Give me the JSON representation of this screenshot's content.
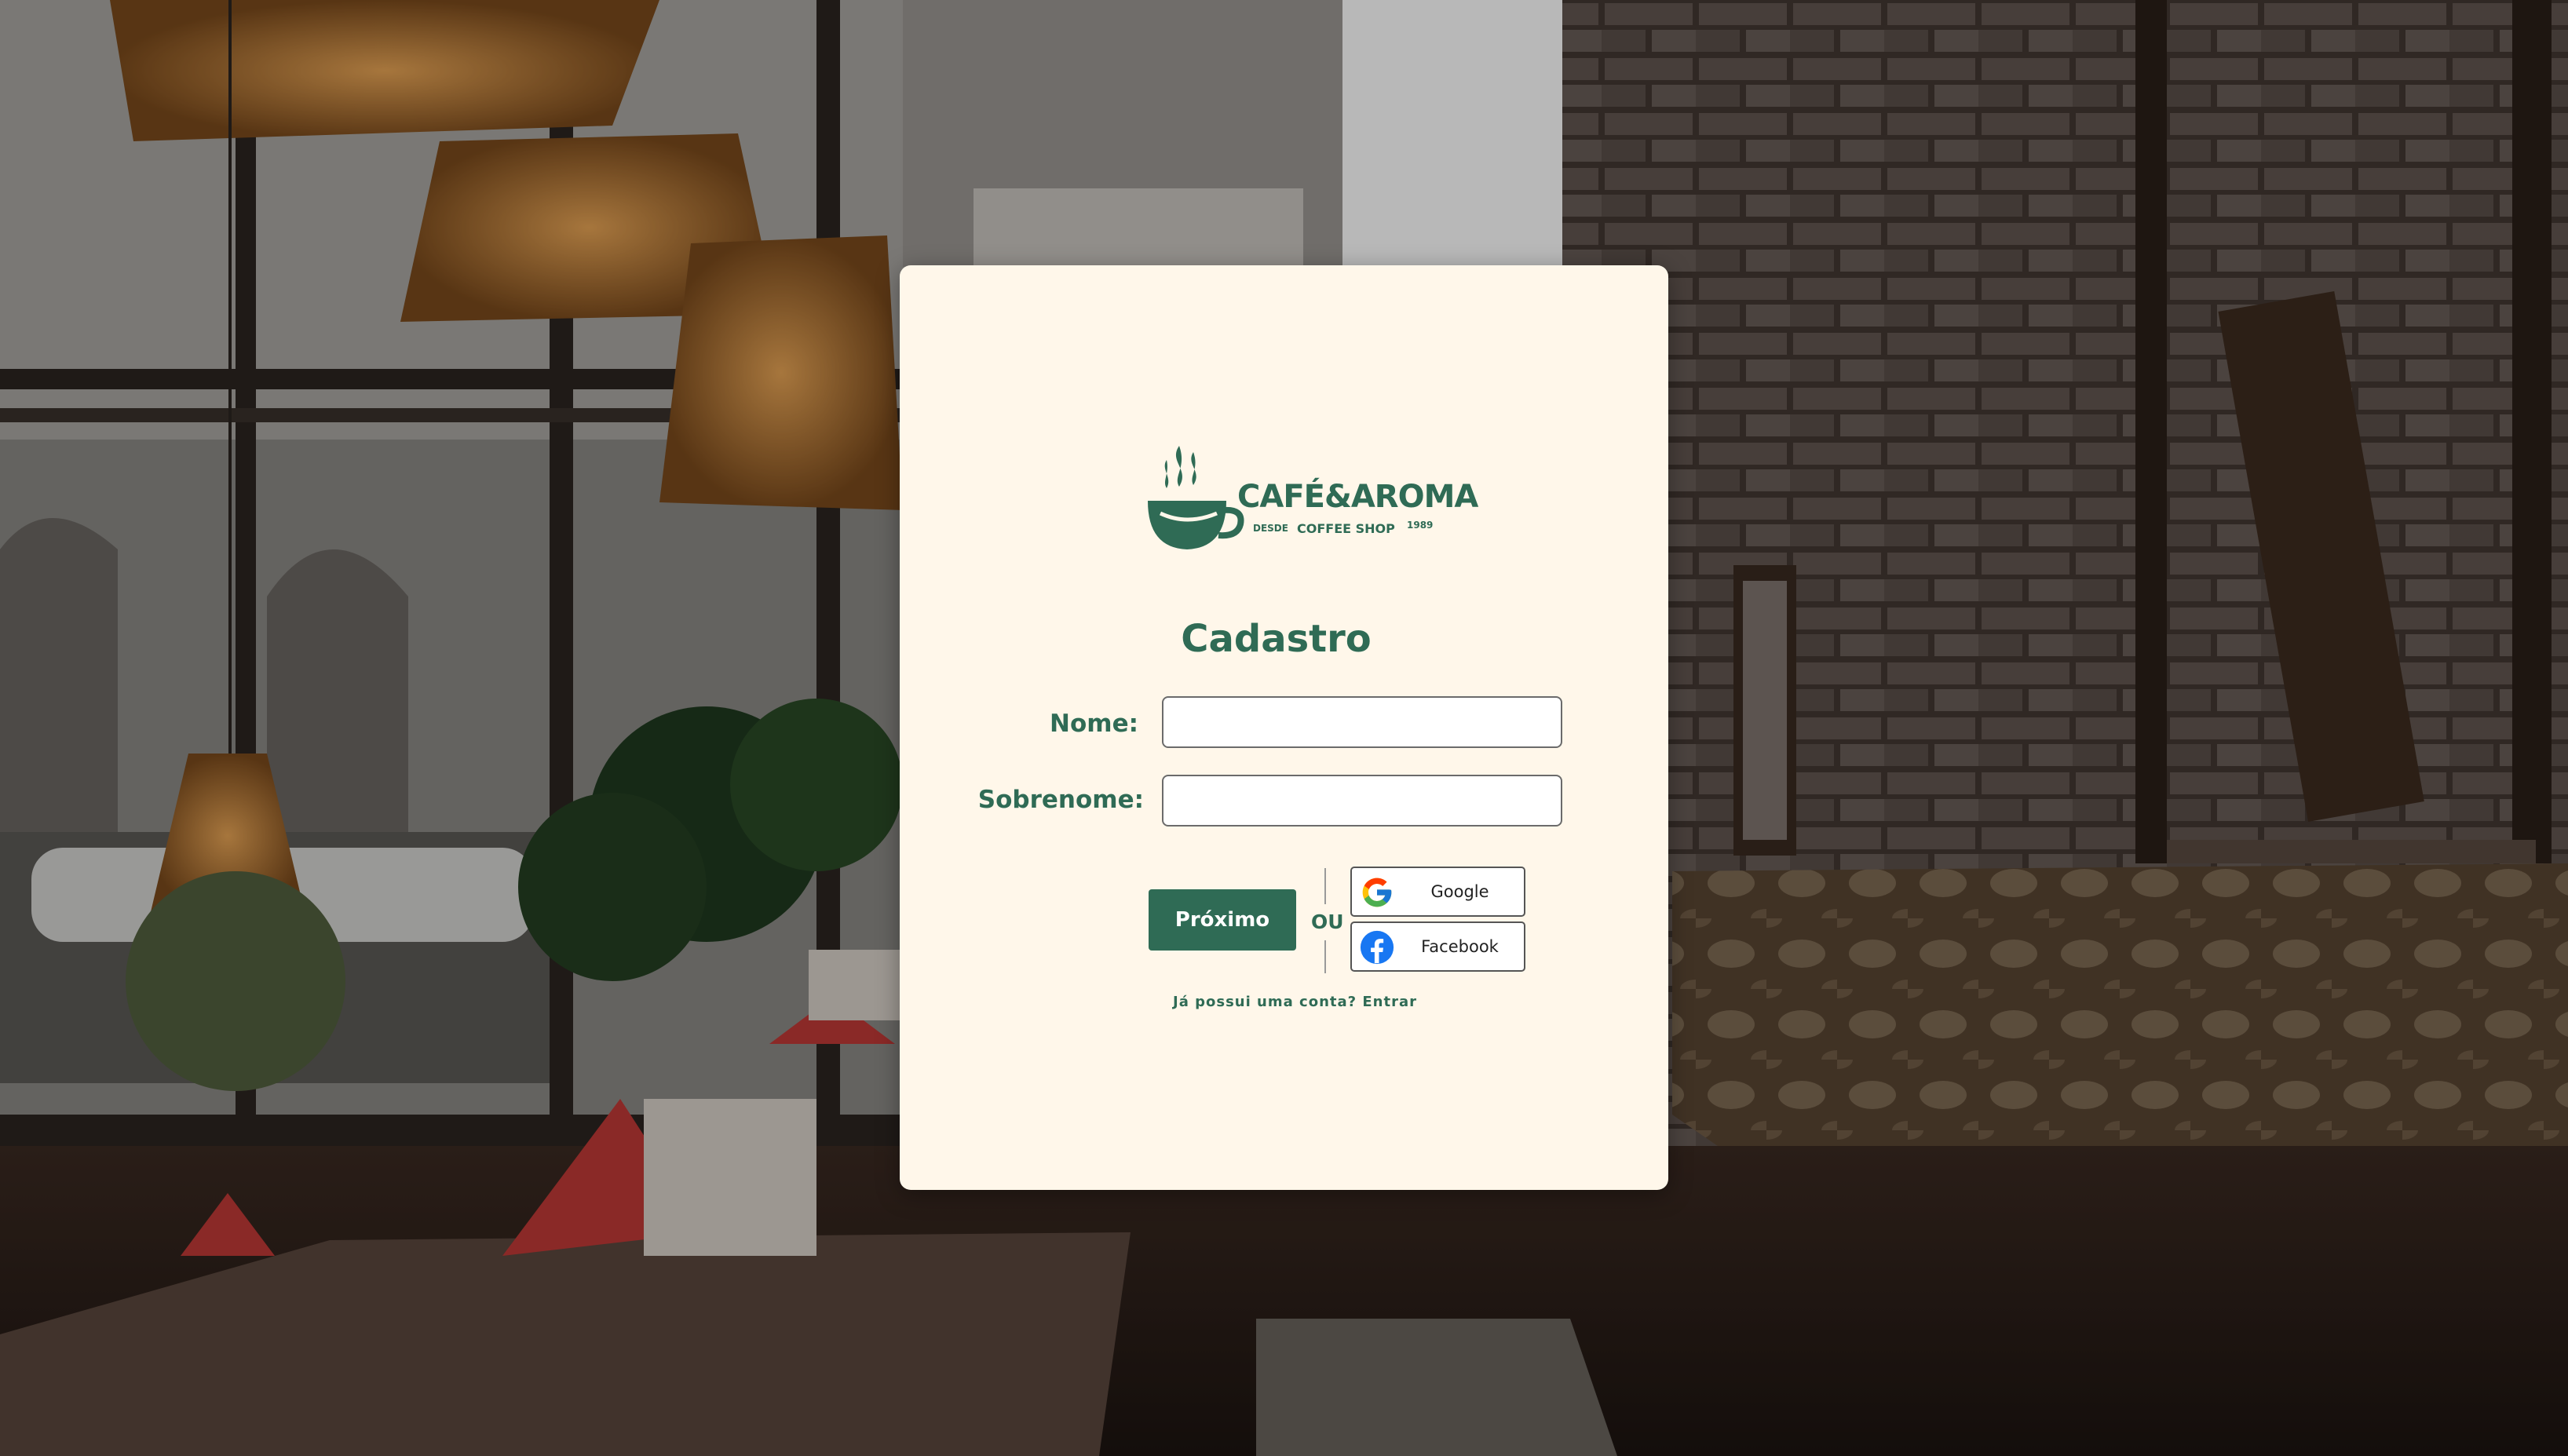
{
  "brand": {
    "name": "CAFÉ&AROMA",
    "since": "DESDE",
    "subtitle": "COFFEE SHOP",
    "year": "1989",
    "color": "#2f6b55"
  },
  "form": {
    "title": "Cadastro",
    "fields": [
      {
        "label": "Nome:",
        "value": "",
        "placeholder": ""
      },
      {
        "label": "Sobrenome:",
        "value": "",
        "placeholder": ""
      }
    ],
    "next_label": "Próximo",
    "or_label": "OU",
    "social": {
      "google_label": "Google",
      "facebook_label": "Facebook"
    },
    "login_link": "Já possui uma conta? Entrar"
  },
  "icons": {
    "logo": "coffee-cup-steam-icon",
    "google": "google-icon",
    "facebook": "facebook-icon"
  },
  "colors": {
    "card_background": "#fff7ea",
    "accent": "#2f6b55",
    "facebook_blue": "#1877f2"
  }
}
